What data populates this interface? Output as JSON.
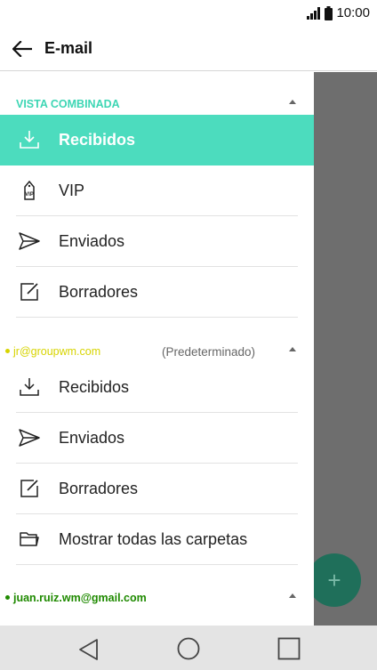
{
  "status_bar": {
    "time": "10:00"
  },
  "app_bar": {
    "title": "E-mail"
  },
  "drawer": {
    "combined": {
      "header": "VISTA COMBINADA",
      "header_color": "#3dd6b4",
      "items": [
        {
          "label": "Recibidos",
          "icon": "inbox-icon",
          "active": true
        },
        {
          "label": "VIP",
          "icon": "vip-tag-icon"
        },
        {
          "label": "Enviados",
          "icon": "send-icon"
        },
        {
          "label": "Borradores",
          "icon": "draft-icon"
        }
      ]
    },
    "account1": {
      "email": "jr@groupwm.com",
      "badge": "(Predeterminado)",
      "color": "#d7d400",
      "items": [
        {
          "label": "Recibidos",
          "icon": "inbox-icon"
        },
        {
          "label": "Enviados",
          "icon": "send-icon"
        },
        {
          "label": "Borradores",
          "icon": "draft-icon"
        },
        {
          "label": "Mostrar todas las carpetas",
          "icon": "folder-icon"
        }
      ]
    },
    "account2": {
      "email": "juan.ruiz.wm@gmail.com",
      "color": "#1f8a00"
    }
  },
  "colors": {
    "active_row": "#4cdcbe",
    "scrim": "#6e6e6e",
    "fab": "#1f6f5a"
  }
}
